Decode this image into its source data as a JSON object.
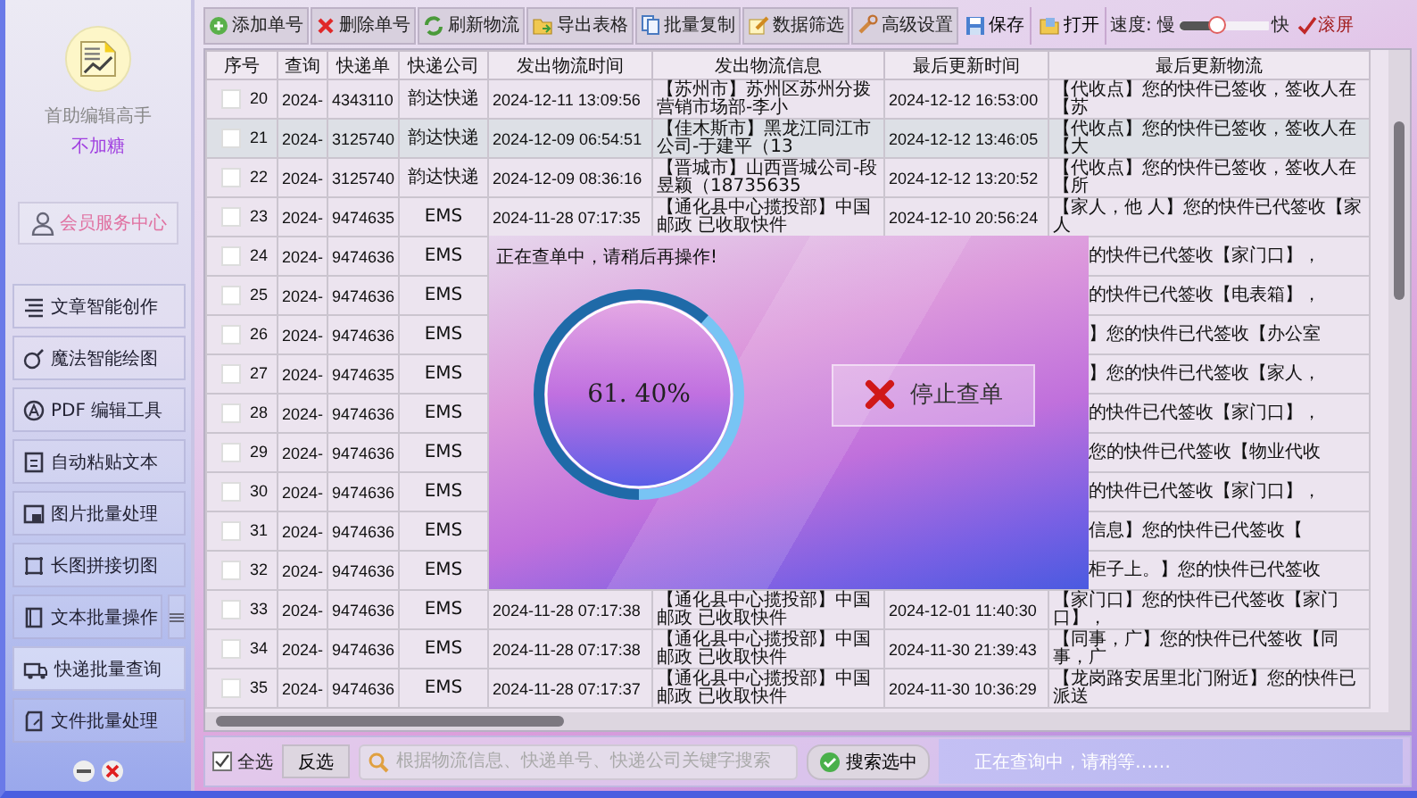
{
  "app": {
    "name": "首助编辑高手",
    "subtitle": "不加糖",
    "member_button": "会员服务中心"
  },
  "nav": [
    {
      "label": "文章智能创作",
      "selected": false,
      "menu_button": false
    },
    {
      "label": "魔法智能绘图",
      "selected": false,
      "menu_button": false
    },
    {
      "label": "PDF 编辑工具",
      "selected": false,
      "menu_button": false
    },
    {
      "label": "自动粘贴文本",
      "selected": false,
      "menu_button": false
    },
    {
      "label": "图片批量处理",
      "selected": false,
      "menu_button": false
    },
    {
      "label": "长图拼接切图",
      "selected": false,
      "menu_button": false
    },
    {
      "label": "文本批量操作",
      "selected": false,
      "menu_button": true
    },
    {
      "label": "快递批量查询",
      "selected": true,
      "menu_button": false
    },
    {
      "label": "文件批量处理",
      "selected": false,
      "menu_button": false
    }
  ],
  "toolbar": {
    "buttons": [
      "添加单号",
      "删除单号",
      "刷新物流",
      "导出表格",
      "批量复制",
      "数据筛选",
      "高级设置"
    ],
    "file_buttons": [
      "保存",
      "打开"
    ],
    "speed": {
      "label": "速度: 慢",
      "level": 0.43,
      "fast_label": "快"
    },
    "scroll": {
      "label": "滚屏",
      "checked": true
    }
  },
  "table": {
    "columns": [
      "序号",
      "查询",
      "快递单",
      "快递公司",
      "发出物流时间",
      "发出物流信息",
      "最后更新时间",
      "最后更新物流"
    ],
    "rows": [
      {
        "no": "20",
        "query": "2024-",
        "tracking": "4343110",
        "company": "韵达快递",
        "sent_time": "2024-12-11 13:09:56",
        "sent_info": "【苏州市】苏州区苏州分拨营销市场部-李小",
        "updated_time": "2024-12-12 16:53:00",
        "latest": "【代收点】您的快件已签收，签收人在【苏",
        "checked": false,
        "selected": false
      },
      {
        "no": "21",
        "query": "2024-",
        "tracking": "3125740",
        "company": "韵达快递",
        "sent_time": "2024-12-09 06:54:51",
        "sent_info": "【佳木斯市】黑龙江同江市公司-于建平（13",
        "updated_time": "2024-12-12 13:46:05",
        "latest": "【代收点】您的快件已签收，签收人在【大",
        "checked": false,
        "selected": true
      },
      {
        "no": "22",
        "query": "2024-",
        "tracking": "3125740",
        "company": "韵达快递",
        "sent_time": "2024-12-09 08:36:16",
        "sent_info": "【晋城市】山西晋城公司-段昱颖（18735635",
        "updated_time": "2024-12-12 13:20:52",
        "latest": "【代收点】您的快件已签收，签收人在【所",
        "checked": false,
        "selected": false
      },
      {
        "no": "23",
        "query": "2024-",
        "tracking": "9474635",
        "company": "EMS",
        "sent_time": "2024-11-28 07:17:35",
        "sent_info": "【通化县中心揽投部】中国邮政 已收取快件",
        "updated_time": "2024-12-10 20:56:24",
        "latest": "【家人，他 人】您的快件已代签收【家人",
        "checked": false,
        "selected": false
      },
      {
        "no": "24",
        "query": "2024-",
        "tracking": "9474636",
        "company": "EMS",
        "latest": "的快件已代签收【家门口】，",
        "checked": false,
        "selected": false
      },
      {
        "no": "25",
        "query": "2024-",
        "tracking": "9474636",
        "company": "EMS",
        "latest": "的快件已代签收【电表箱】，",
        "checked": false,
        "selected": false
      },
      {
        "no": "26",
        "query": "2024-",
        "tracking": "9474636",
        "company": "EMS",
        "latest": "】您的快件已代签收【办公室",
        "checked": false,
        "selected": false
      },
      {
        "no": "27",
        "query": "2024-",
        "tracking": "9474635",
        "company": "EMS",
        "latest": "】您的快件已代签收【家人，",
        "checked": false,
        "selected": false
      },
      {
        "no": "28",
        "query": "2024-",
        "tracking": "9474636",
        "company": "EMS",
        "latest": "的快件已代签收【家门口】，",
        "checked": false,
        "selected": false
      },
      {
        "no": "29",
        "query": "2024-",
        "tracking": "9474636",
        "company": "EMS",
        "latest": "您的快件已代签收【物业代收",
        "checked": false,
        "selected": false
      },
      {
        "no": "30",
        "query": "2024-",
        "tracking": "9474636",
        "company": "EMS",
        "latest": "的快件已代签收【家门口】，",
        "checked": false,
        "selected": false
      },
      {
        "no": "31",
        "query": "2024-",
        "tracking": "9474636",
        "company": "EMS",
        "latest": "信息】您的快件已代签收【",
        "checked": false,
        "selected": false
      },
      {
        "no": "32",
        "query": "2024-",
        "tracking": "9474636",
        "company": "EMS",
        "latest": "柜子上。】您的快件已代签收",
        "checked": false,
        "selected": false
      },
      {
        "no": "33",
        "query": "2024-",
        "tracking": "9474636",
        "company": "EMS",
        "sent_time": "2024-11-28 07:17:38",
        "sent_info": "【通化县中心揽投部】中国邮政 已收取快件",
        "updated_time": "2024-12-01 11:40:30",
        "latest": "【家门口】您的快件已代签收【家门口】，",
        "checked": false,
        "selected": false
      },
      {
        "no": "34",
        "query": "2024-",
        "tracking": "9474636",
        "company": "EMS",
        "sent_time": "2024-11-28 07:17:38",
        "sent_info": "【通化县中心揽投部】中国邮政 已收取快件",
        "updated_time": "2024-11-30 21:39:43",
        "latest": "【同事，广】您的快件已代签收【同事，广",
        "checked": false,
        "selected": false
      },
      {
        "no": "35",
        "query": "2024-",
        "tracking": "9474636",
        "company": "EMS",
        "sent_time": "2024-11-28 07:17:37",
        "sent_info": "【通化县中心揽投部】中国邮政 已收取快件",
        "updated_time": "2024-11-30 10:36:29",
        "latest": "【龙岗路安居里北门附近】您的快件已派送",
        "checked": false,
        "selected": false
      }
    ]
  },
  "progress": {
    "title": "正在查单中，请稍后再操作!",
    "level": 0.614,
    "percent": "61. 40%",
    "stop_button": "停止查单"
  },
  "bottom": {
    "select_all": {
      "label": "全选",
      "checked": true
    },
    "invert_button": "反选",
    "search": {
      "placeholder": "根据物流信息、快递单号、快递公司关键字搜索"
    },
    "search_button": "搜索选中",
    "status": "正在查询中，请稍等……"
  }
}
